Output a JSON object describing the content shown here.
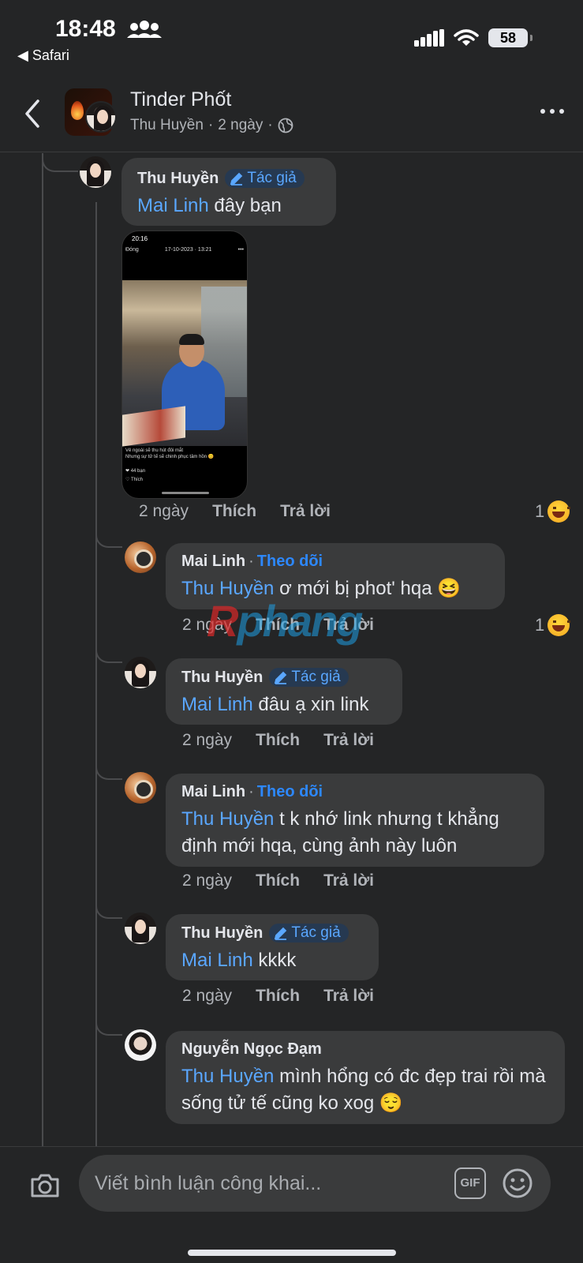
{
  "status_bar": {
    "time": "18:48",
    "back_app": "◀ Safari",
    "battery": "58"
  },
  "header": {
    "title": "Tinder Phốt",
    "author": "Thu Huyền",
    "dot1": "·",
    "time": "2 ngày",
    "dot2": "·",
    "privacy_icon": "globe-icon"
  },
  "labels": {
    "author_badge": "Tác giả",
    "follow": "Theo dõi",
    "sep": "·",
    "like": "Thích",
    "reply": "Trả lời"
  },
  "comments": [
    {
      "name": "Thu Huyền",
      "badge": "author",
      "mention": "Mai Linh",
      "text": " đây bạn",
      "time": "2 ngày",
      "reactions": "1",
      "reaction_icon": "grin-squint-emoji"
    },
    {
      "name": "Mai Linh",
      "badge": "follow",
      "mention": "Thu Huyền",
      "text": " ơ mới bị phot' hqa 😆",
      "time": "2 ngày",
      "reactions": "1",
      "reaction_icon": "grin-squint-emoji"
    },
    {
      "name": "Thu Huyền",
      "badge": "author",
      "mention": "Mai Linh",
      "text": " đâu ạ xin link",
      "time": "2 ngày"
    },
    {
      "name": "Mai Linh",
      "badge": "follow",
      "mention": "Thu Huyền",
      "text": " t k nhớ link nhưng t khẳng định mới hqa, cùng ảnh này luôn",
      "time": "2 ngày"
    },
    {
      "name": "Thu Huyền",
      "badge": "author",
      "mention": "Mai Linh",
      "text": " kkkk",
      "time": "2 ngày"
    },
    {
      "name": "Nguyễn Ngọc Đạm",
      "badge": "none",
      "mention": "Thu Huyền",
      "text": " mình hổng có đc đẹp trai rồi mà sống tử tế cũng ko xog 😌"
    }
  ],
  "photo": {
    "status_time": "20:16",
    "back": "Đóng",
    "date": "17-10-2023 · 13:21",
    "dots": "•••",
    "caption_line1": "Vẻ ngoài sẽ thu hút đôi mắt",
    "caption_line2": "Nhưng sự tử tế sẽ chinh phục tâm hồn 😊",
    "likes": "❤ 44 bạn",
    "like_btn": "♡ Thích"
  },
  "watermark": {
    "part1": "R",
    "part2": "phang"
  },
  "composer": {
    "placeholder": "Viết bình luận công khai...",
    "gif": "GIF"
  }
}
